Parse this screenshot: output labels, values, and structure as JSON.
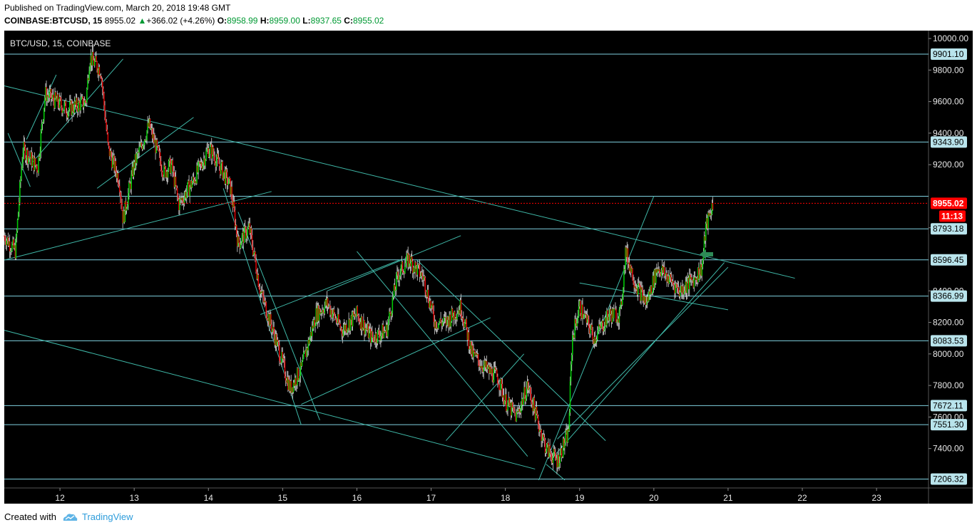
{
  "header": {
    "published": "Published on TradingView.com, March 20, 2018 19:48 GMT",
    "symbol": "COINBASE:BTCUSD, 15",
    "last": "8955.02",
    "change_arrow": "▲",
    "change": "+366.02 (+4.26%)",
    "o_label": "O:",
    "o": "8958.99",
    "h_label": "H:",
    "h": "8959.00",
    "l_label": "L:",
    "l": "8937.65",
    "c_label": "C:",
    "c": "8955.02"
  },
  "footer": {
    "created": "Created with",
    "brand": "TradingView"
  },
  "chart_data": {
    "type": "candlestick",
    "title": "BTC/USD, 15, COINBASE",
    "ylim": [
      7150,
      10050
    ],
    "y_ticks": [
      10000,
      9800,
      9600,
      9400,
      9200,
      8800,
      8400,
      8200,
      8000,
      7800,
      7600,
      7400
    ],
    "y_tick_labels": [
      "10000.00",
      "9800.00",
      "9600.00",
      "9400.00",
      "9200.00",
      "8800.00",
      "8400.00",
      "8200.00",
      "8000.00",
      "7800.00",
      "7600.00",
      "7400.00"
    ],
    "x_range": [
      11.25,
      23.7
    ],
    "x_ticks": [
      12,
      13,
      14,
      15,
      16,
      17,
      18,
      19,
      20,
      21,
      22,
      23
    ],
    "x_tick_labels": [
      "12",
      "13",
      "14",
      "15",
      "16",
      "17",
      "18",
      "19",
      "20",
      "21",
      "22",
      "23"
    ],
    "horizontal_levels": [
      9901.1,
      9343.9,
      8793.18,
      8596.45,
      8366.99,
      8083.53,
      7672.11,
      7551.3,
      7206.32
    ],
    "level_labels": [
      "9901.10",
      "9343.90",
      "8793.18",
      "8596.45",
      "8366.99",
      "8083.53",
      "7672.11",
      "7551.30",
      "7206.32"
    ],
    "extra_level": 9000,
    "current_price": 8955.02,
    "current_price_label": "8955.02",
    "countdown": "11:13",
    "colors": {
      "up": "#00c805",
      "down": "#d50000",
      "level": "#7fd0df",
      "trend": "#3fb8a8",
      "price": "#ff0000",
      "arrow": "#2e8b57"
    },
    "price_path": [
      [
        11.25,
        8750
      ],
      [
        11.4,
        8650
      ],
      [
        11.5,
        9300
      ],
      [
        11.7,
        9180
      ],
      [
        11.8,
        9650
      ],
      [
        12.1,
        9550
      ],
      [
        12.35,
        9600
      ],
      [
        12.4,
        9880
      ],
      [
        12.55,
        9800
      ],
      [
        12.65,
        9300
      ],
      [
        12.8,
        9100
      ],
      [
        12.85,
        8850
      ],
      [
        13.0,
        9200
      ],
      [
        13.2,
        9450
      ],
      [
        13.4,
        9150
      ],
      [
        13.5,
        9200
      ],
      [
        13.6,
        8950
      ],
      [
        13.8,
        9100
      ],
      [
        14.0,
        9300
      ],
      [
        14.05,
        9280
      ],
      [
        14.2,
        9150
      ],
      [
        14.3,
        9050
      ],
      [
        14.4,
        8700
      ],
      [
        14.55,
        8800
      ],
      [
        14.7,
        8400
      ],
      [
        14.9,
        8100
      ],
      [
        15.1,
        7780
      ],
      [
        15.25,
        7900
      ],
      [
        15.45,
        8250
      ],
      [
        15.6,
        8320
      ],
      [
        15.8,
        8150
      ],
      [
        16.0,
        8250
      ],
      [
        16.2,
        8100
      ],
      [
        16.4,
        8150
      ],
      [
        16.55,
        8500
      ],
      [
        16.7,
        8600
      ],
      [
        16.9,
        8480
      ],
      [
        17.05,
        8200
      ],
      [
        17.2,
        8200
      ],
      [
        17.4,
        8300
      ],
      [
        17.55,
        8000
      ],
      [
        17.75,
        7900
      ],
      [
        17.9,
        7850
      ],
      [
        18.0,
        7700
      ],
      [
        18.15,
        7600
      ],
      [
        18.3,
        7800
      ],
      [
        18.45,
        7550
      ],
      [
        18.55,
        7400
      ],
      [
        18.7,
        7320
      ],
      [
        18.85,
        7500
      ],
      [
        18.9,
        8100
      ],
      [
        19.0,
        8300
      ],
      [
        19.2,
        8100
      ],
      [
        19.4,
        8250
      ],
      [
        19.55,
        8250
      ],
      [
        19.62,
        8650
      ],
      [
        19.75,
        8450
      ],
      [
        19.9,
        8320
      ],
      [
        20.05,
        8550
      ],
      [
        20.2,
        8480
      ],
      [
        20.35,
        8400
      ],
      [
        20.55,
        8480
      ],
      [
        20.65,
        8550
      ],
      [
        20.7,
        8800
      ],
      [
        20.8,
        8959
      ]
    ],
    "trend_lines": [
      [
        11.25,
        9700,
        21.9,
        8480
      ],
      [
        11.25,
        8595,
        14.85,
        9030
      ],
      [
        11.25,
        8150,
        18.4,
        7270
      ],
      [
        11.3,
        9400,
        11.6,
        9060
      ],
      [
        11.55,
        9360,
        11.95,
        9770
      ],
      [
        11.6,
        9200,
        12.85,
        9870
      ],
      [
        12.5,
        9050,
        13.8,
        9500
      ],
      [
        14.2,
        9050,
        15.25,
        7550
      ],
      [
        14.4,
        8900,
        15.5,
        7580
      ],
      [
        15.25,
        7680,
        17.8,
        8230
      ],
      [
        14.7,
        8250,
        16.6,
        8600
      ],
      [
        15.6,
        8400,
        17.4,
        8750
      ],
      [
        16.0,
        8650,
        18.3,
        7350
      ],
      [
        16.8,
        8600,
        19.35,
        7450
      ],
      [
        17.2,
        7450,
        18.25,
        8000
      ],
      [
        18.45,
        7200,
        20.0,
        9000
      ],
      [
        18.65,
        7350,
        20.95,
        8580
      ],
      [
        18.7,
        7460,
        21.0,
        8550
      ],
      [
        19.0,
        8450,
        21.0,
        8280
      ],
      [
        18.55,
        7300,
        18.8,
        7200
      ]
    ]
  }
}
